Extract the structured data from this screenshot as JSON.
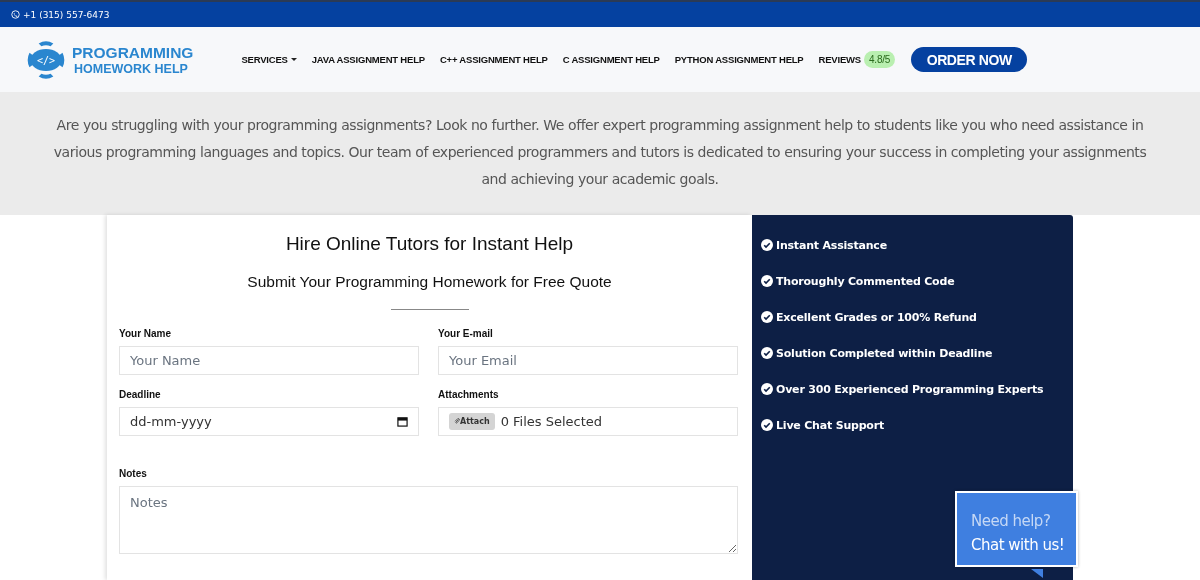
{
  "top_bar": {
    "phone": "+1 (315) 557-6473"
  },
  "header": {
    "logo_mark": "</>",
    "logo_line_1": "PROGRAMMING",
    "logo_line_2": "HOMEWORK HELP",
    "nav": [
      {
        "label": "SERVICES",
        "kind": "dropdown"
      },
      {
        "label": "JAVA ASSIGNMENT HELP",
        "kind": "link"
      },
      {
        "label": "C++ ASSIGNMENT HELP",
        "kind": "link"
      },
      {
        "label": "C ASSIGNMENT HELP",
        "kind": "link"
      },
      {
        "label": "PYTHON ASSIGNMENT HELP",
        "kind": "link"
      },
      {
        "label": "REVIEWS",
        "kind": "rating",
        "badge": "4.8/5"
      }
    ],
    "order_button": "ORDER NOW"
  },
  "intro": "Are you struggling with your programming assignments? Look no further. We offer expert programming assignment help to students like you who need assistance in various programming languages and topics. Our team of experienced programmers and tutors is dedicated to ensuring your success in completing your assignments and achieving your academic goals.",
  "form": {
    "title": "Hire Online Tutors for Instant Help",
    "subtitle": "Submit Your Programming Homework for Free Quote",
    "fields": [
      {
        "label": "Your Name",
        "kind": "text",
        "placeholder": "Your Name"
      },
      {
        "label": "Your E-mail",
        "kind": "text",
        "placeholder": "Your Email"
      },
      {
        "label": "Deadline",
        "kind": "date",
        "value": "dd-mm-yyyy"
      },
      {
        "label": "Attachments",
        "kind": "file",
        "button": "Attach",
        "value": "0 Files Selected"
      },
      {
        "label": "Notes",
        "kind": "textarea",
        "placeholder": "Notes"
      }
    ]
  },
  "benefits": [
    "Instant Assistance",
    "Thoroughly Commented Code",
    "Excellent Grades or 100% Refund",
    "Solution Completed within Deadline",
    "Over 300 Experienced Programming Experts",
    "Live Chat Support"
  ],
  "chat": {
    "line_1": "Need help?",
    "line_2": "Chat with us!"
  }
}
